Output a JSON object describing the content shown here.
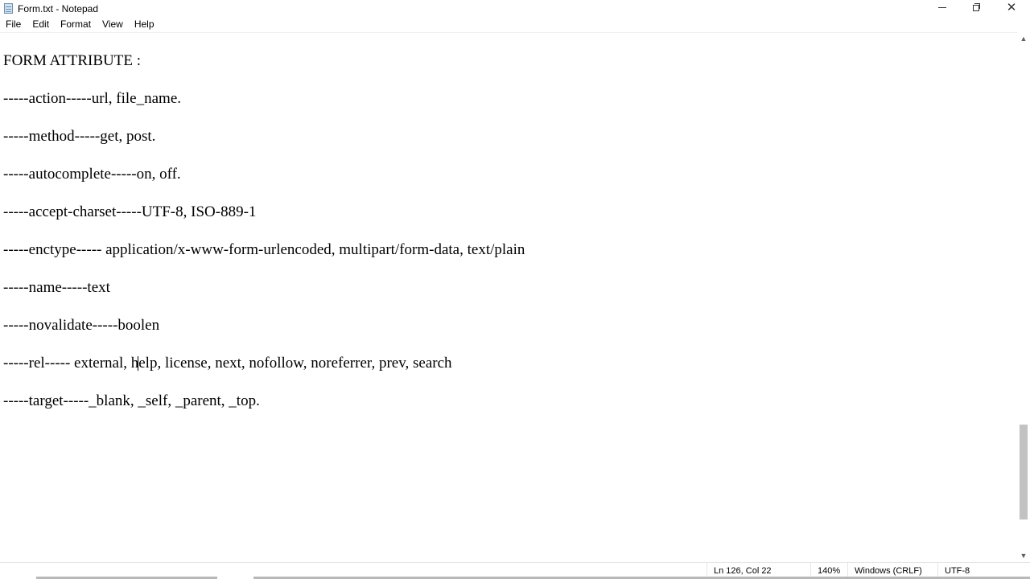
{
  "window": {
    "title": "Form.txt - Notepad",
    "icon": "notepad-icon"
  },
  "menu": {
    "file": "File",
    "edit": "Edit",
    "format": "Format",
    "view": "View",
    "help": "Help"
  },
  "editor": {
    "lines": [
      "FORM ATTRIBUTE :",
      "-----action-----url, file_name.",
      "-----method-----get, post.",
      "-----autocomplete-----on, off.",
      "-----accept-charset-----UTF-8, ISO-889-1",
      "-----enctype----- application/x-www-form-urlencoded, multipart/form-data, text/plain",
      "-----name-----text",
      "-----novalidate-----boolen",
      "-----rel----- external, help, license, next, nofollow, noreferrer, prev, search",
      "-----target-----_blank, _self, _parent, _top."
    ]
  },
  "status": {
    "position": "Ln 126, Col 22",
    "zoom": "140%",
    "line_ending": "Windows (CRLF)",
    "encoding": "UTF-8"
  },
  "colors": {
    "background": "#ffffff",
    "text": "#000000",
    "scroll_thumb": "#c2c2c2"
  }
}
